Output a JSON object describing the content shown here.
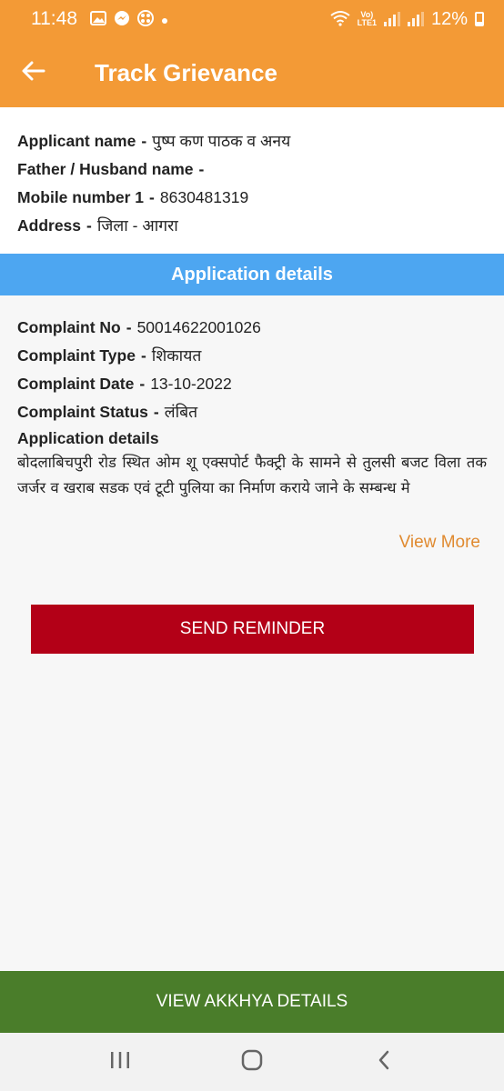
{
  "status_bar": {
    "time": "11:48",
    "lte": [
      "Vo)",
      "LTE1"
    ],
    "battery": "12%"
  },
  "app_bar": {
    "title": "Track Grievance"
  },
  "applicant": {
    "name_label": "Applicant name",
    "name_value": "पुष्प कण पाठक व अनय",
    "father_label": "Father / Husband name",
    "father_value": "",
    "mobile_label": "Mobile number 1",
    "mobile_value": "8630481319",
    "address_label": "Address",
    "address_value": "जिला - आगरा"
  },
  "section": {
    "title": "Application details"
  },
  "complaint": {
    "no_label": "Complaint No",
    "no_value": "50014622001026",
    "type_label": "Complaint Type",
    "type_value": "शिकायत",
    "date_label": "Complaint Date",
    "date_value": "13-10-2022",
    "status_label": "Complaint Status",
    "status_value": "लंबित",
    "details_label": "Application details",
    "details_value": "बोदलाबिचपुरी रोड स्थित ओम शू एक्सपोर्ट फैक्ट्री के सामने से तुलसी बजट विला तक जर्जर व खराब सडक एवं टूटी पुलिया का निर्माण कराये जाने के सम्बन्ध मे"
  },
  "actions": {
    "view_more": "View More",
    "send_reminder": "SEND REMINDER",
    "view_akkhya": "VIEW AKKHYA DETAILS"
  },
  "icons": {
    "back": "arrow-left-icon",
    "nav_recents": "recents-icon",
    "nav_home": "home-icon",
    "nav_back": "chevron-left-icon"
  },
  "colors": {
    "header": "#f39a36",
    "section": "#4da6f1",
    "reminder": "#b30017",
    "akkhya": "#4a7d2a",
    "status_accent": "#e08a30"
  }
}
